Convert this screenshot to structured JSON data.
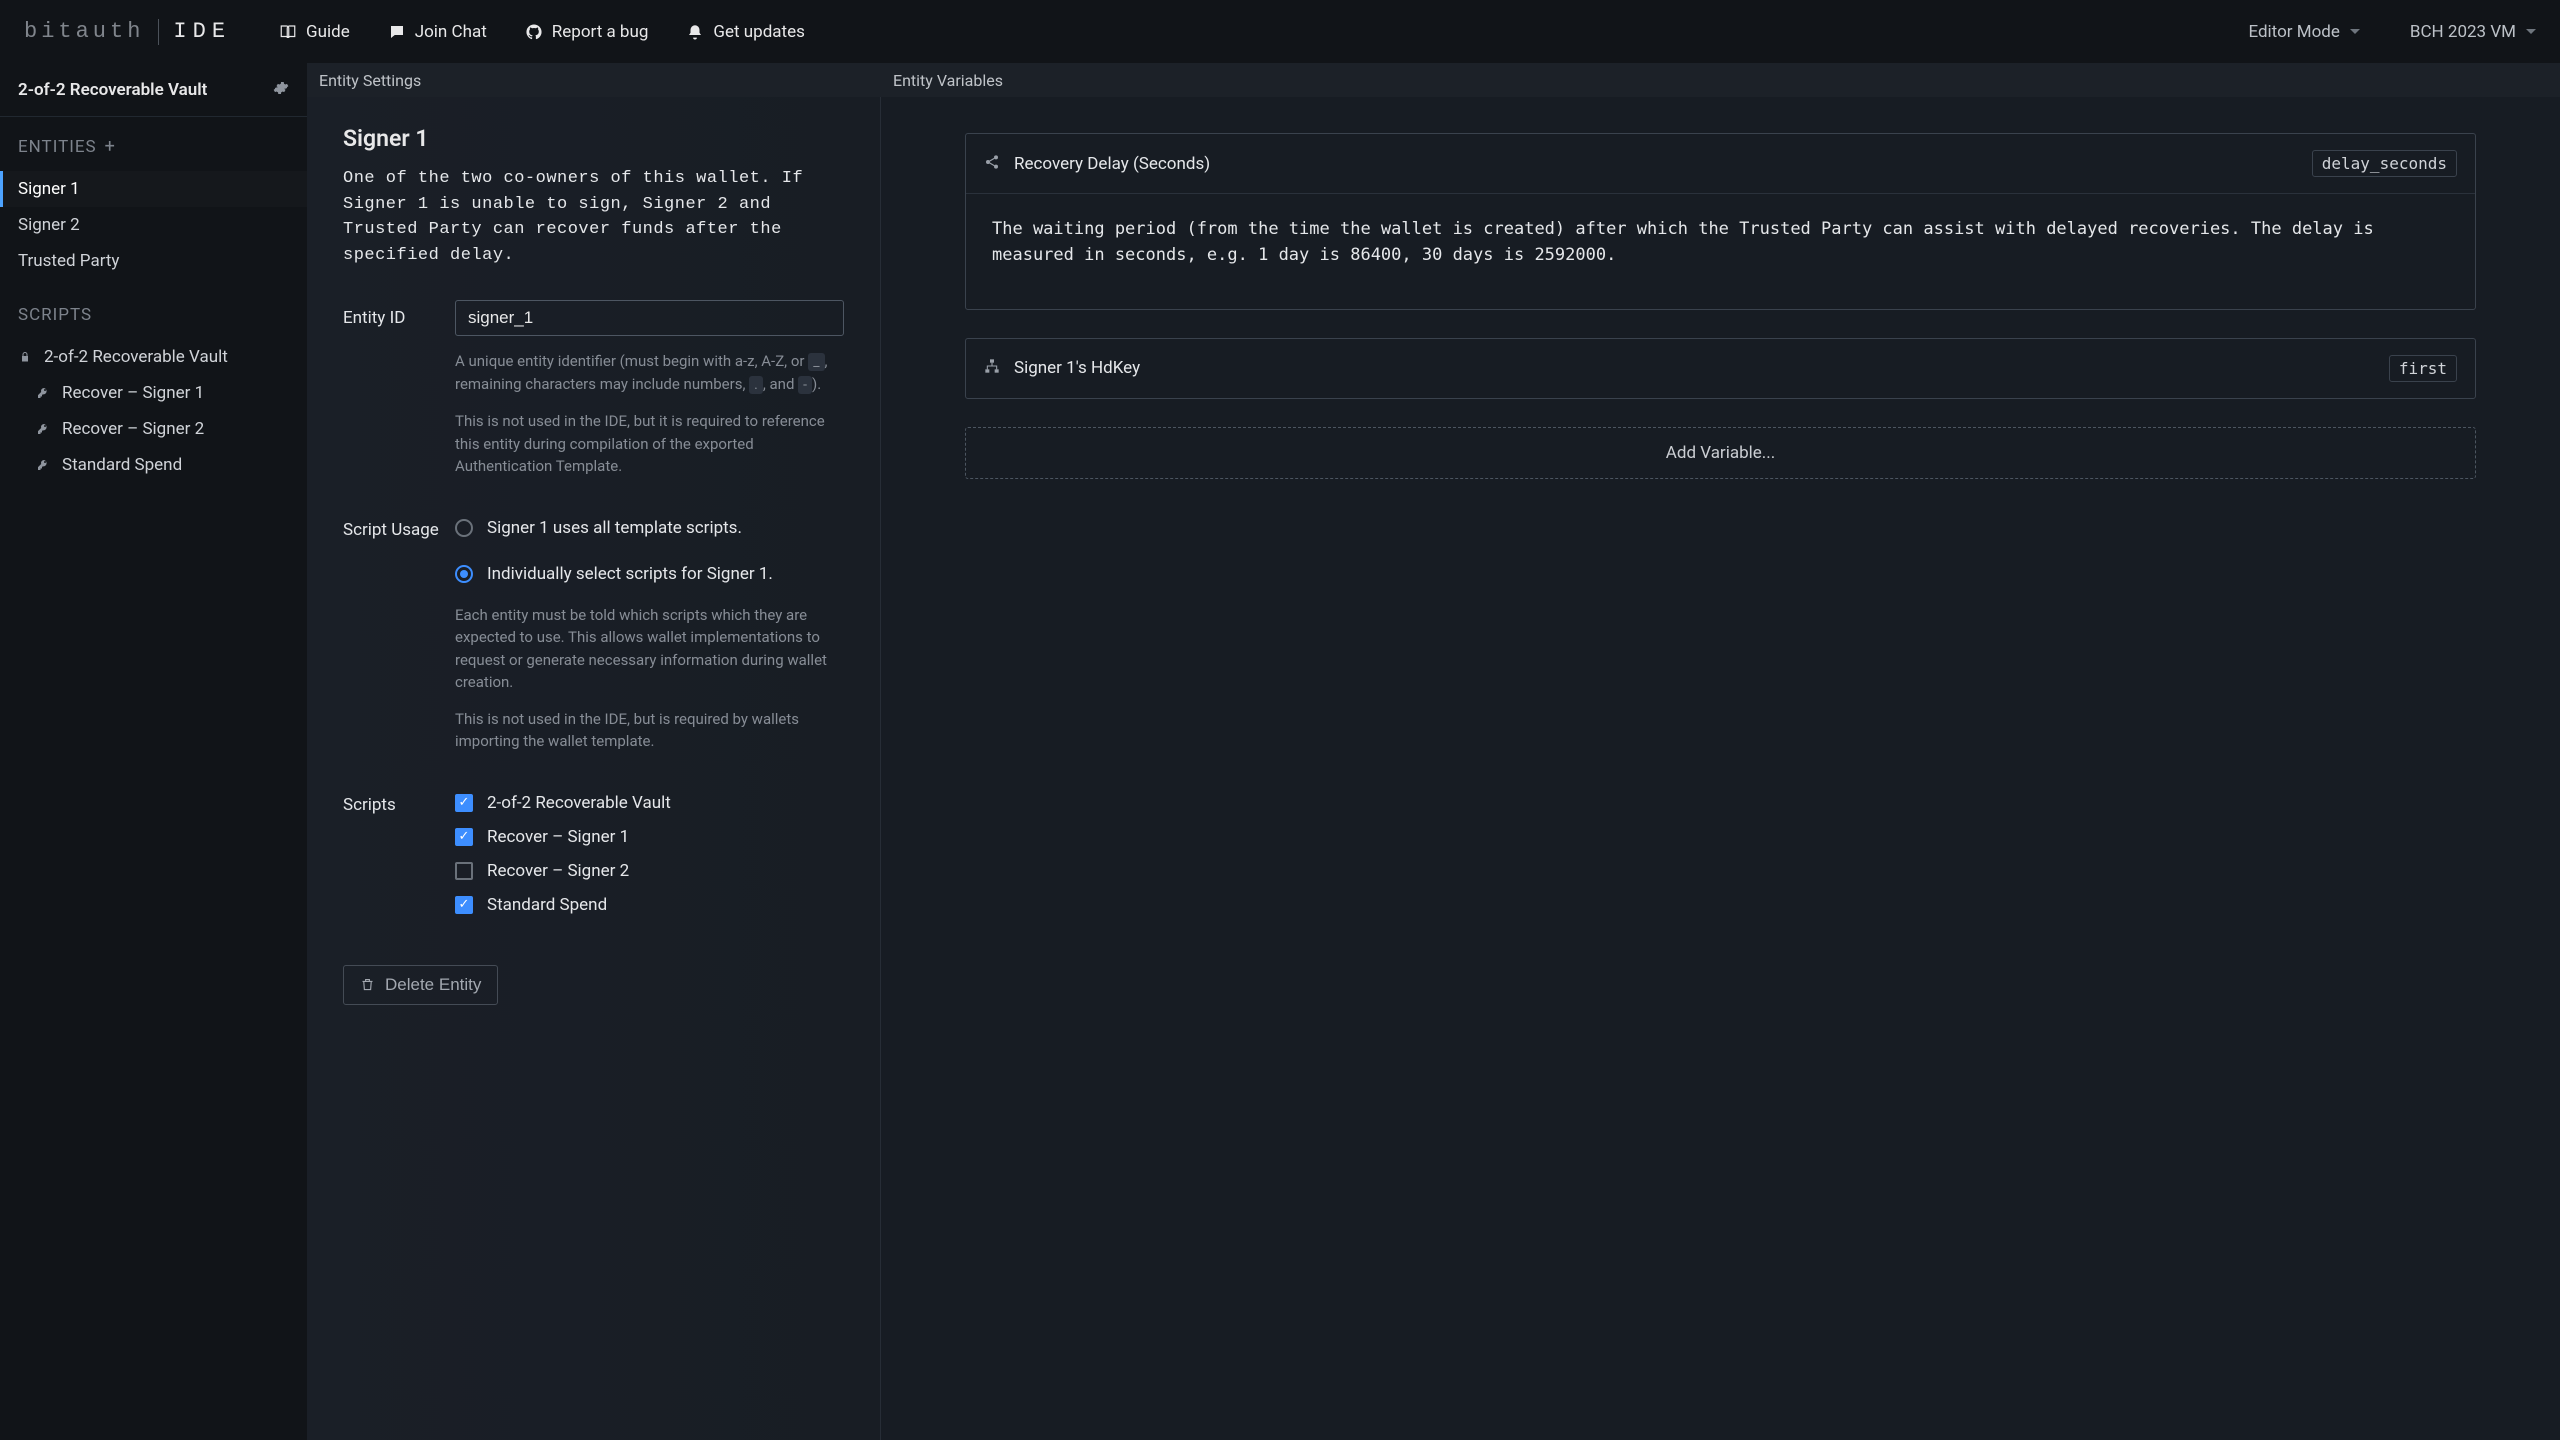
{
  "brand": {
    "bitauth": "bitauth",
    "ide": "IDE"
  },
  "topnav": {
    "guide": "Guide",
    "join_chat": "Join Chat",
    "report_bug": "Report a bug",
    "get_updates": "Get updates"
  },
  "topright": {
    "editor_mode": "Editor Mode",
    "vm": "BCH 2023 VM"
  },
  "project": {
    "name": "2-of-2 Recoverable Vault"
  },
  "sidebar": {
    "entities_heading": "ENTITIES",
    "scripts_heading": "SCRIPTS",
    "entities": [
      {
        "label": "Signer 1",
        "active": true
      },
      {
        "label": "Signer 2",
        "active": false
      },
      {
        "label": "Trusted Party",
        "active": false
      }
    ],
    "scripts": [
      {
        "label": "2-of-2 Recoverable Vault",
        "kind": "lock",
        "child": false
      },
      {
        "label": "Recover – Signer 1",
        "kind": "key",
        "child": true
      },
      {
        "label": "Recover – Signer 2",
        "kind": "key",
        "child": true
      },
      {
        "label": "Standard Spend",
        "kind": "key",
        "child": true
      }
    ]
  },
  "panes": {
    "settings_title": "Entity Settings",
    "variables_title": "Entity Variables"
  },
  "entity": {
    "title": "Signer 1",
    "description": "One of the two co-owners of this wallet. If Signer 1 is unable to sign, Signer 2 and Trusted Party can recover funds after the specified delay.",
    "id_label": "Entity ID",
    "id_value": "signer_1",
    "id_help_1a": "A unique entity identifier (must begin with a-z, A-Z, or ",
    "id_help_1b": ", remaining characters may include numbers, ",
    "id_help_1c": ", and ",
    "id_help_1d": ").",
    "id_help_code_underscore": "_",
    "id_help_code_dot": ".",
    "id_help_code_dash": "-",
    "id_help_2": "This is not used in the IDE, but it is required to reference this entity during compilation of the exported Authentication Template.",
    "usage_label": "Script Usage",
    "usage_options": [
      {
        "label": "Signer 1 uses all template scripts.",
        "selected": false
      },
      {
        "label": "Individually select scripts for Signer 1.",
        "selected": true
      }
    ],
    "usage_help_1": "Each entity must be told which scripts which they are expected to use. This allows wallet implementations to request or generate necessary information during wallet creation.",
    "usage_help_2": "This is not used in the IDE, but is required by wallets importing the wallet template.",
    "scripts_label": "Scripts",
    "script_checks": [
      {
        "label": "2-of-2 Recoverable Vault",
        "checked": true
      },
      {
        "label": "Recover – Signer 1",
        "checked": true
      },
      {
        "label": "Recover – Signer 2",
        "checked": false
      },
      {
        "label": "Standard Spend",
        "checked": true
      }
    ],
    "delete_label": "Delete Entity"
  },
  "variables": {
    "items": [
      {
        "name": "Recovery Delay (Seconds)",
        "id": "delay_seconds",
        "icon": "share",
        "description": "The waiting period (from the time the wallet is created) after which the Trusted Party can assist with delayed recoveries. The delay is measured in seconds, e.g. 1 day is 86400, 30 days is 2592000."
      },
      {
        "name": "Signer 1's HdKey",
        "id": "first",
        "icon": "hierarchy",
        "description": null
      }
    ],
    "add_label": "Add Variable..."
  }
}
